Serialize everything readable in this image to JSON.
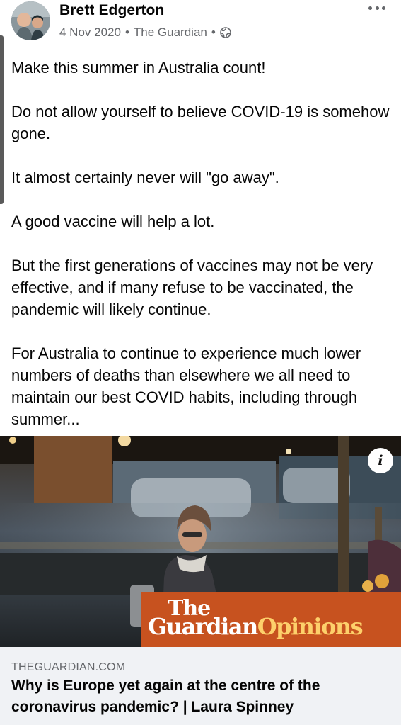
{
  "post": {
    "author": "Brett Edgerton",
    "date": "4 Nov 2020",
    "separator": "•",
    "source": "The Guardian",
    "privacy_icon": "globe-icon",
    "more_icon": "more-horizontal-icon",
    "paragraphs": [
      "Make this summer in Australia count!",
      "Do not allow yourself to believe COVID-19 is somehow gone.",
      "It almost certainly never will \"go away\".",
      "A good vaccine will help a lot.",
      "But the first generations of vaccines may not be very effective, and if many refuse to be vaccinated, the pandemic will likely continue.",
      "For Australia to continue to experience much lower numbers of deaths than elsewhere we all need to maintain our best COVID habits, including through summer..."
    ]
  },
  "link": {
    "info_label": "i",
    "brand_line1": "The",
    "brand_line2": "Guardian",
    "brand_line2_accent": "Opinions",
    "domain": "THEGUARDIAN.COM",
    "title": "Why is Europe yet again at the centre of the coronavirus pandemic? | Laura Spinney"
  },
  "colors": {
    "brand_orange": "#c7521f",
    "brand_yellow": "#fdd06b",
    "meta_grey": "#65676b",
    "caption_bg": "#f0f2f5"
  }
}
